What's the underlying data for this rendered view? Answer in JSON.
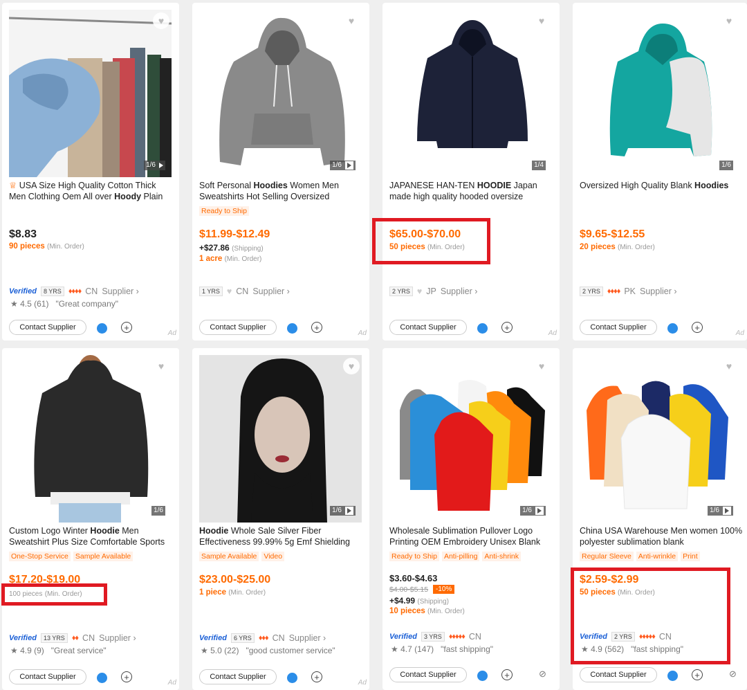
{
  "common": {
    "contact": "Contact Supplier",
    "ad": "Ad",
    "heart": "♥",
    "plus": "+",
    "eye": "⊘",
    "min": "(Min. Order)",
    "ship_note": "(Shipping)",
    "star": "★"
  },
  "products": [
    {
      "counter": "1/6",
      "title_pre": "USA Size High Quality Cotton Thick Men Clothing Oem All over ",
      "title_bold": "Hoody",
      "title_post": " Plain",
      "crown": "♕",
      "price": "$8.83",
      "moq": "90 pieces",
      "verified": "Verified",
      "yrs": "8 YRS",
      "diamonds": "♦♦♦♦",
      "country": "CN",
      "supplier": "Supplier ›",
      "rating": "★ 4.5 (61)",
      "review": "\"Great company\""
    },
    {
      "counter": "1/6",
      "title_pre": "Soft Personal ",
      "title_bold": "Hoodies",
      "title_post": " Women Men Sweatshirts Hot Selling Oversized",
      "tags": [
        "Ready to Ship"
      ],
      "price": "$11.99-$12.49",
      "shipping": "+$27.86",
      "moq": "1 acre",
      "yrs": "1 YRS",
      "diamonds": "♥",
      "country": "CN",
      "supplier": "Supplier ›"
    },
    {
      "counter": "1/4",
      "title_pre": "JAPANESE HAN-TEN ",
      "title_bold": "HOODIE",
      "title_post": " Japan made high quality hooded oversize",
      "price": "$65.00-$70.00",
      "moq": "50 pieces",
      "yrs": "2 YRS",
      "diamonds": "♥",
      "country": "JP",
      "supplier": "Supplier ›"
    },
    {
      "counter": "1/6",
      "title_pre": "Oversized High Quality Blank ",
      "title_bold": "Hoodies",
      "title_post": "",
      "price": "$9.65-$12.55",
      "moq": "20 pieces",
      "yrs": "2 YRS",
      "diamonds": "♦♦♦♦",
      "country": "PK",
      "supplier": "Supplier ›"
    },
    {
      "counter": "1/6",
      "title_pre": "Custom Logo Winter ",
      "title_bold": "Hoodie",
      "title_post": " Men Sweatshirt Plus Size Comfortable Sports",
      "tags": [
        "One-Stop Service",
        "Sample Available"
      ],
      "price": "$17.20-$19.00",
      "moq": "100 pieces",
      "verified": "Verified",
      "yrs": "13 YRS",
      "diamonds": "♦♦",
      "country": "CN",
      "supplier": "Supplier ›",
      "rating": "★ 4.9 (9)",
      "review": "\"Great service\""
    },
    {
      "counter": "1/6",
      "title_pre": "",
      "title_bold": "Hoodie",
      "title_post": " Whole Sale Silver Fiber Effectiveness 99.99% 5g Emf Shielding",
      "tags": [
        "Sample Available",
        "Video"
      ],
      "price": "$23.00-$25.00",
      "moq": "1 piece",
      "verified": "Verified",
      "yrs": "6 YRS",
      "diamonds": "♦♦♦",
      "country": "CN",
      "supplier": "Supplier ›",
      "rating": "★ 5.0 (22)",
      "review": "\"good customer service\""
    },
    {
      "counter": "1/6",
      "title_pre": "Wholesale Sublimation Pullover Logo Printing OEM Embroidery Unisex Blank",
      "title_bold": "",
      "title_post": "",
      "tags": [
        "Ready to Ship",
        "Anti-pilling",
        "Anti-shrink"
      ],
      "price": "$3.60-$4.63",
      "strike": "$4.00-$5.15",
      "discount": "-10%",
      "shipping": "+$4.99",
      "moq": "10 pieces",
      "verified": "Verified",
      "yrs": "3 YRS",
      "diamonds": "♦♦♦♦♦",
      "country": "CN",
      "rating": "★ 4.7 (147)",
      "review": "\"fast shipping\""
    },
    {
      "counter": "1/6",
      "title_pre": "China USA Warehouse Men women 100% polyester sublimation blank",
      "title_bold": "",
      "title_post": "",
      "tags": [
        "Regular Sleeve",
        "Anti-wrinkle",
        "Print"
      ],
      "price": "$2.59-$2.99",
      "moq": "50 pieces",
      "verified": "Verified",
      "yrs": "2 YRS",
      "diamonds": "♦♦♦♦♦",
      "country": "CN",
      "rating": "★ 4.9 (562)",
      "review": "\"fast shipping\""
    }
  ]
}
